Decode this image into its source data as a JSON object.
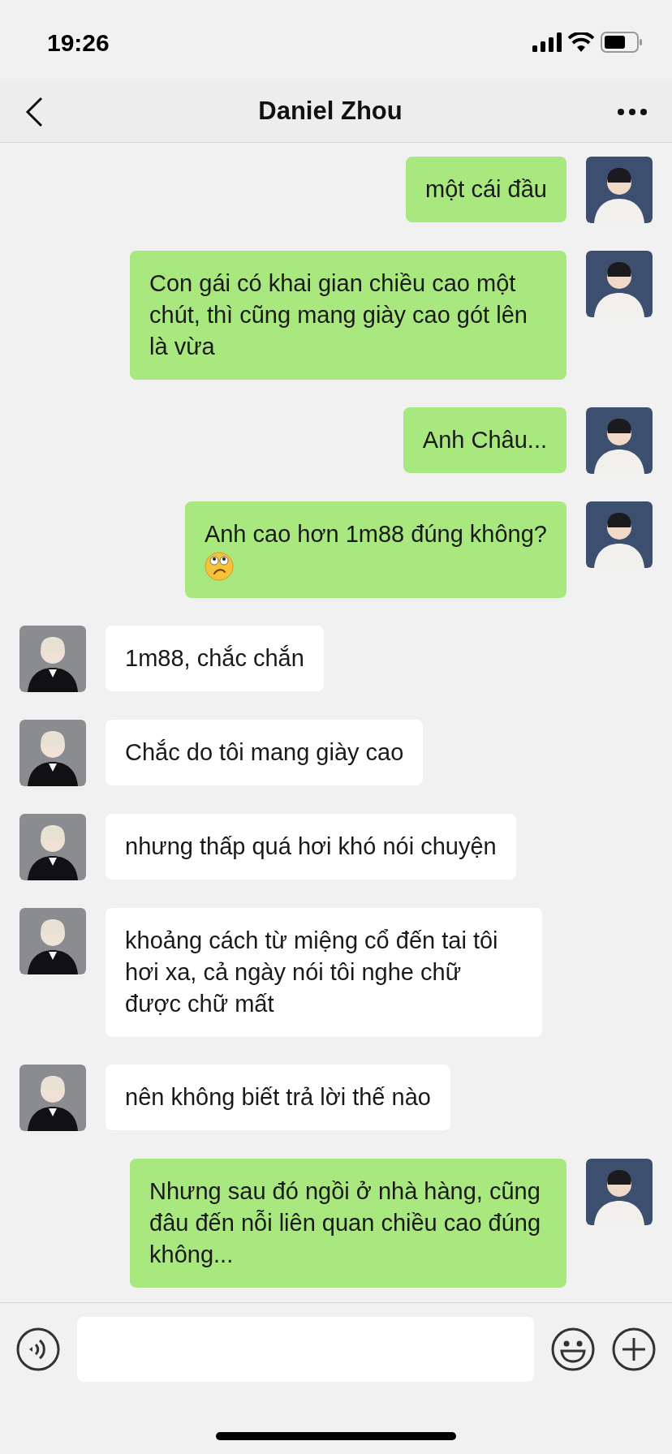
{
  "status_bar": {
    "time": "19:26"
  },
  "header": {
    "title": "Daniel Zhou"
  },
  "messages": [
    {
      "kind": "sent",
      "text": "một cái đầu"
    },
    {
      "kind": "sent",
      "text": "Con gái có khai gian chiều cao một chút, thì cũng mang giày cao gót lên là vừa"
    },
    {
      "kind": "sent",
      "text": "Anh Châu..."
    },
    {
      "kind": "sent",
      "text": "Anh cao hơn 1m88 đúng không?",
      "emoji": true
    },
    {
      "kind": "received",
      "text": "1m88, chắc chắn"
    },
    {
      "kind": "received",
      "text": "Chắc do tôi mang giày cao"
    },
    {
      "kind": "received",
      "text": "nhưng thấp quá hơi khó nói chuyện"
    },
    {
      "kind": "received",
      "text": "khoảng cách từ miệng cổ đến tai tôi hơi xa, cả ngày nói tôi nghe chữ được chữ mất"
    },
    {
      "kind": "received",
      "text": "nên không biết trả lời thế nào"
    },
    {
      "kind": "sent",
      "text": "Nhưng sau đó ngồi ở nhà hàng, cũng đâu đến nỗi liên quan chiều cao đúng không..."
    }
  ]
}
